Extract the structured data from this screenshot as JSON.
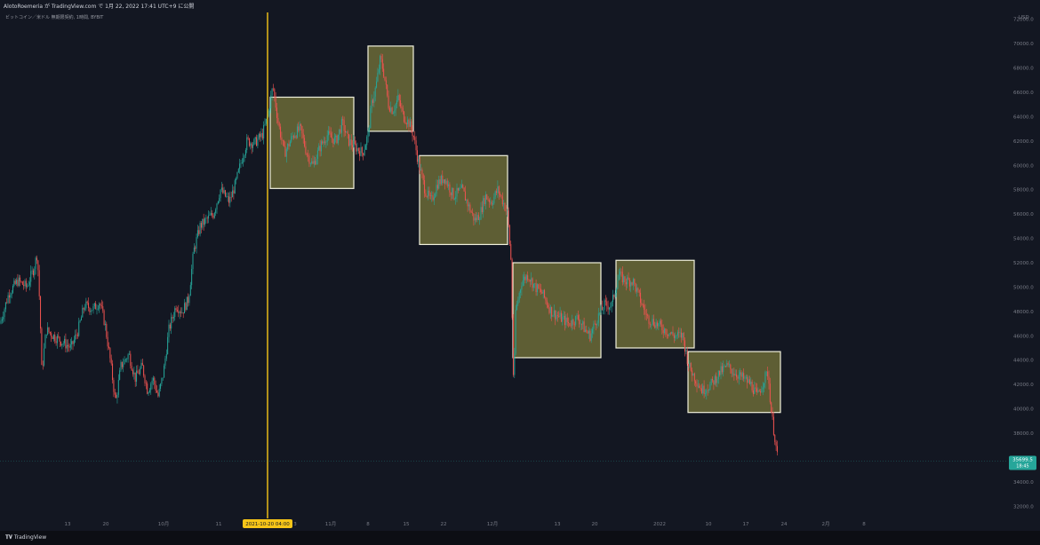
{
  "header": {
    "text": "AlotoRoemeria が TradingView.com で 1月 22, 2022 17:41 UTC+9 に公開"
  },
  "symbol": {
    "text": "ビットコイン／米ドル 無期限契約, 1時間, BYBIT"
  },
  "footer": {
    "logo_text": "TradingView"
  },
  "chart_data": {
    "type": "candlestick",
    "currency_label": "USD",
    "ylim": [
      31000,
      73000
    ],
    "y_ticks": [
      "32000.0",
      "34000.0",
      "36000.0",
      "38000.0",
      "40000.0",
      "42000.0",
      "44000.0",
      "46000.0",
      "48000.0",
      "50000.0",
      "52000.0",
      "54000.0",
      "56000.0",
      "58000.0",
      "60000.0",
      "62000.0",
      "64000.0",
      "66000.0",
      "68000.0",
      "70000.0",
      "72000.0"
    ],
    "x_ticks": [
      "13",
      "20",
      "10月",
      "11",
      "2021-10-20   04:00",
      "3",
      "11月",
      "8",
      "15",
      "22",
      "12月",
      "13",
      "20",
      "2022",
      "10",
      "17",
      "24",
      "2月",
      "8"
    ],
    "x_ticks_idx": [
      76,
      119,
      184,
      246,
      301,
      332,
      372,
      414,
      457,
      499,
      554,
      627,
      669,
      742,
      797,
      839,
      882,
      929,
      972
    ],
    "vertical_marker": {
      "x_idx": 301,
      "label": "2021-10-20   04:00"
    },
    "last_price": {
      "value": 35699.5,
      "label": "35699.5",
      "countdown": "18:45"
    },
    "price_path": [
      [
        0,
        47000
      ],
      [
        10,
        49500
      ],
      [
        20,
        50500
      ],
      [
        30,
        50000
      ],
      [
        38,
        51500
      ],
      [
        42,
        52800
      ],
      [
        45,
        48000
      ],
      [
        47,
        43000
      ],
      [
        52,
        46500
      ],
      [
        60,
        46000
      ],
      [
        70,
        45500
      ],
      [
        80,
        45000
      ],
      [
        88,
        46500
      ],
      [
        95,
        48500
      ],
      [
        105,
        48200
      ],
      [
        112,
        48800
      ],
      [
        118,
        47000
      ],
      [
        124,
        44000
      ],
      [
        130,
        40500
      ],
      [
        136,
        43500
      ],
      [
        145,
        44500
      ],
      [
        152,
        42500
      ],
      [
        160,
        43500
      ],
      [
        166,
        41500
      ],
      [
        172,
        42500
      ],
      [
        178,
        41000
      ],
      [
        184,
        43000
      ],
      [
        190,
        46500
      ],
      [
        198,
        48500
      ],
      [
        205,
        48000
      ],
      [
        212,
        49000
      ],
      [
        218,
        53000
      ],
      [
        225,
        55000
      ],
      [
        232,
        55500
      ],
      [
        240,
        56000
      ],
      [
        248,
        58000
      ],
      [
        258,
        57000
      ],
      [
        265,
        58500
      ],
      [
        272,
        60500
      ],
      [
        278,
        62000
      ],
      [
        286,
        61800
      ],
      [
        295,
        62500
      ],
      [
        301,
        64000
      ],
      [
        307,
        66500
      ],
      [
        313,
        63500
      ],
      [
        320,
        61000
      ],
      [
        330,
        62500
      ],
      [
        338,
        63000
      ],
      [
        345,
        61000
      ],
      [
        352,
        60000
      ],
      [
        360,
        61500
      ],
      [
        368,
        62500
      ],
      [
        378,
        62000
      ],
      [
        385,
        63500
      ],
      [
        392,
        62000
      ],
      [
        400,
        61500
      ],
      [
        408,
        61000
      ],
      [
        414,
        62500
      ],
      [
        418,
        65000
      ],
      [
        423,
        66500
      ],
      [
        428,
        68800
      ],
      [
        432,
        67500
      ],
      [
        437,
        65000
      ],
      [
        442,
        64500
      ],
      [
        448,
        65500
      ],
      [
        454,
        64000
      ],
      [
        460,
        63500
      ],
      [
        465,
        62500
      ],
      [
        470,
        60500
      ],
      [
        478,
        58000
      ],
      [
        485,
        57000
      ],
      [
        492,
        58500
      ],
      [
        500,
        59000
      ],
      [
        510,
        57500
      ],
      [
        520,
        58000
      ],
      [
        528,
        56500
      ],
      [
        534,
        55500
      ],
      [
        540,
        56000
      ],
      [
        546,
        57500
      ],
      [
        553,
        57000
      ],
      [
        560,
        58000
      ],
      [
        566,
        57000
      ],
      [
        571,
        56000
      ],
      [
        575,
        52000
      ],
      [
        577,
        44000
      ],
      [
        578,
        41500
      ],
      [
        580,
        48000
      ],
      [
        587,
        50500
      ],
      [
        594,
        51000
      ],
      [
        602,
        50000
      ],
      [
        610,
        49500
      ],
      [
        620,
        48000
      ],
      [
        630,
        47500
      ],
      [
        640,
        47000
      ],
      [
        650,
        47500
      ],
      [
        658,
        46500
      ],
      [
        664,
        46000
      ],
      [
        672,
        47500
      ],
      [
        680,
        48500
      ],
      [
        688,
        48500
      ],
      [
        696,
        51000
      ],
      [
        704,
        50500
      ],
      [
        712,
        50500
      ],
      [
        720,
        49000
      ],
      [
        728,
        47500
      ],
      [
        738,
        47000
      ],
      [
        748,
        46500
      ],
      [
        758,
        46000
      ],
      [
        768,
        46000
      ],
      [
        775,
        43500
      ],
      [
        782,
        42500
      ],
      [
        790,
        41500
      ],
      [
        800,
        42000
      ],
      [
        810,
        43000
      ],
      [
        818,
        43500
      ],
      [
        826,
        43000
      ],
      [
        836,
        42500
      ],
      [
        845,
        42000
      ],
      [
        852,
        41000
      ],
      [
        860,
        42500
      ],
      [
        864,
        43000
      ],
      [
        868,
        39500
      ],
      [
        872,
        37500
      ],
      [
        875,
        35700
      ]
    ],
    "boxes": [
      {
        "x0_idx": 304,
        "x1_idx": 398,
        "y_top": 65600,
        "y_bottom": 58100
      },
      {
        "x0_idx": 414,
        "x1_idx": 465,
        "y_top": 69800,
        "y_bottom": 62800
      },
      {
        "x0_idx": 472,
        "x1_idx": 571,
        "y_top": 60800,
        "y_bottom": 53500
      },
      {
        "x0_idx": 577,
        "x1_idx": 676,
        "y_top": 52000,
        "y_bottom": 44200
      },
      {
        "x0_idx": 693,
        "x1_idx": 781,
        "y_top": 52200,
        "y_bottom": 45000
      },
      {
        "x0_idx": 774,
        "x1_idx": 878,
        "y_top": 44700,
        "y_bottom": 39700
      }
    ],
    "colors": {
      "background": "#131722",
      "up": "#26a69a",
      "down": "#ef5350",
      "box_fill": "#7c7a3c",
      "box_border": "#f0f0dc",
      "marker": "#f5c518",
      "last_price": "#26a69a",
      "axis_text": "#787b86"
    }
  }
}
